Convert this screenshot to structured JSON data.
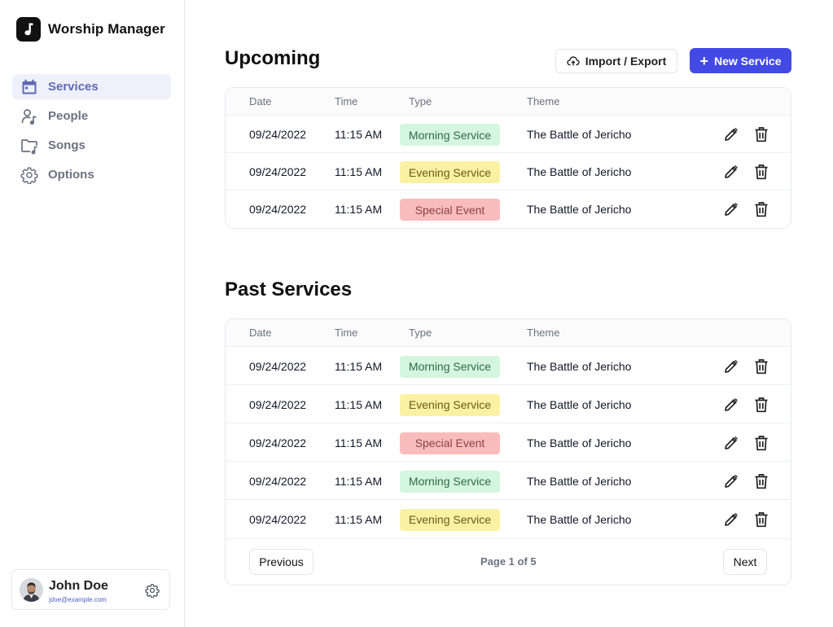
{
  "app": {
    "name": "Worship Manager"
  },
  "nav": {
    "items": [
      {
        "label": "Services",
        "icon": "calendar-icon",
        "active": true
      },
      {
        "label": "People",
        "icon": "person-music-icon",
        "active": false
      },
      {
        "label": "Songs",
        "icon": "folder-music-icon",
        "active": false
      },
      {
        "label": "Options",
        "icon": "gear-icon",
        "active": false
      }
    ]
  },
  "user": {
    "name": "John Doe",
    "email": "jdoe@example.com"
  },
  "toolbar": {
    "import_label": "Import / Export",
    "new_label": "New Service"
  },
  "columns": {
    "date": "Date",
    "time": "Time",
    "type": "Type",
    "theme": "Theme"
  },
  "type_colors": {
    "Morning Service": {
      "bg": "#d4f5de",
      "fg": "#2f6b47"
    },
    "Evening Service": {
      "bg": "#fbf1a3",
      "fg": "#6b5a16"
    },
    "Special Event": {
      "bg": "#f9bcbc",
      "fg": "#8a4343"
    }
  },
  "upcoming": {
    "title": "Upcoming",
    "rows": [
      {
        "date": "09/24/2022",
        "time": "11:15 AM",
        "type": "Morning Service",
        "theme": "The Battle of Jericho"
      },
      {
        "date": "09/24/2022",
        "time": "11:15 AM",
        "type": "Evening Service",
        "theme": "The Battle of Jericho"
      },
      {
        "date": "09/24/2022",
        "time": "11:15 AM",
        "type": "Special Event",
        "theme": "The Battle of Jericho"
      }
    ]
  },
  "past": {
    "title": "Past Services",
    "rows": [
      {
        "date": "09/24/2022",
        "time": "11:15 AM",
        "type": "Morning Service",
        "theme": "The Battle of Jericho"
      },
      {
        "date": "09/24/2022",
        "time": "11:15 AM",
        "type": "Evening Service",
        "theme": "The Battle of Jericho"
      },
      {
        "date": "09/24/2022",
        "time": "11:15 AM",
        "type": "Special Event",
        "theme": "The Battle of Jericho"
      },
      {
        "date": "09/24/2022",
        "time": "11:15 AM",
        "type": "Morning Service",
        "theme": "The Battle of Jericho"
      },
      {
        "date": "09/24/2022",
        "time": "11:15 AM",
        "type": "Evening Service",
        "theme": "The Battle of Jericho"
      }
    ],
    "pagination": {
      "previous": "Previous",
      "info": "Page 1 of 5",
      "next": "Next"
    }
  },
  "accent": "#4349e5"
}
